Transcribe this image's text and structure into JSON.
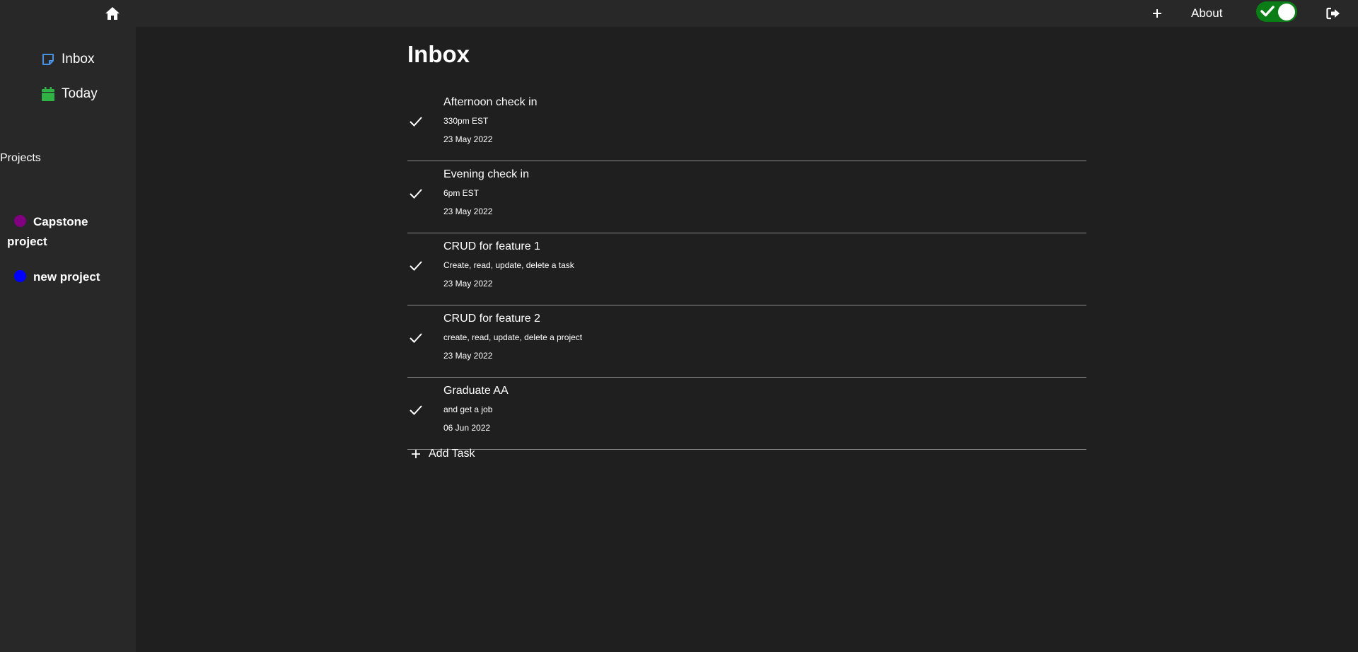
{
  "topbar": {
    "home_icon": "home-icon",
    "add_icon": "plus-icon",
    "about_label": "About",
    "theme_toggle_on": true,
    "toggle_color": "#0a7d16",
    "logout_icon": "logout-icon"
  },
  "sidebar": {
    "nav": [
      {
        "label": "Inbox",
        "icon": "inbox-icon",
        "color": "#4a90e2"
      },
      {
        "label": "Today",
        "icon": "calendar-icon",
        "color": "#2fb344"
      }
    ],
    "projects_heading": "Projects",
    "projects": [
      {
        "label": "Capstone project",
        "color": "#800080"
      },
      {
        "label": "new project",
        "color": "#0000ff"
      }
    ]
  },
  "main": {
    "title": "Inbox",
    "tasks": [
      {
        "title": "Afternoon check in",
        "description": "330pm EST",
        "date": "23 May 2022"
      },
      {
        "title": "Evening check in",
        "description": "6pm EST",
        "date": "23 May 2022"
      },
      {
        "title": "CRUD for feature 1",
        "description": "Create, read, update, delete a task",
        "date": "23 May 2022"
      },
      {
        "title": "CRUD for feature 2",
        "description": "create, read, update, delete a project",
        "date": "23 May 2022"
      },
      {
        "title": "Graduate AA",
        "description": "and get a job",
        "date": "06 Jun 2022"
      }
    ],
    "add_task_label": "Add Task"
  }
}
